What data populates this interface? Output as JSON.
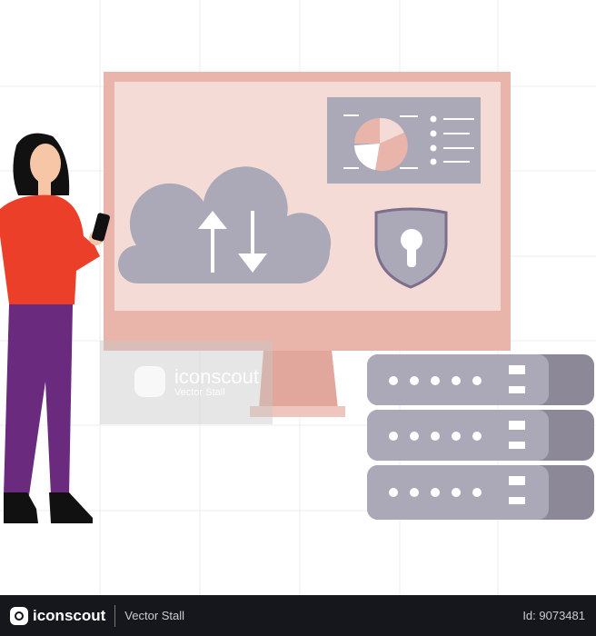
{
  "watermark": {
    "brand": "iconscout",
    "author": "Vector Stall"
  },
  "footer": {
    "brand": "iconscout",
    "author": "Vector Stall",
    "id_label": "Id: 9073481"
  },
  "colors": {
    "monitor_frame": "#e9b5aa",
    "screen": "#f5dbd6",
    "grey": "#aba8b8",
    "outline": "#7c6f8c",
    "shirt": "#ec3f2a",
    "pants": "#6a2a7e",
    "footer_bg": "#16171d"
  },
  "icons": [
    "cloud-transfer-icon",
    "shield-lock-icon",
    "pie-chart-icon",
    "server-rack-icon"
  ]
}
